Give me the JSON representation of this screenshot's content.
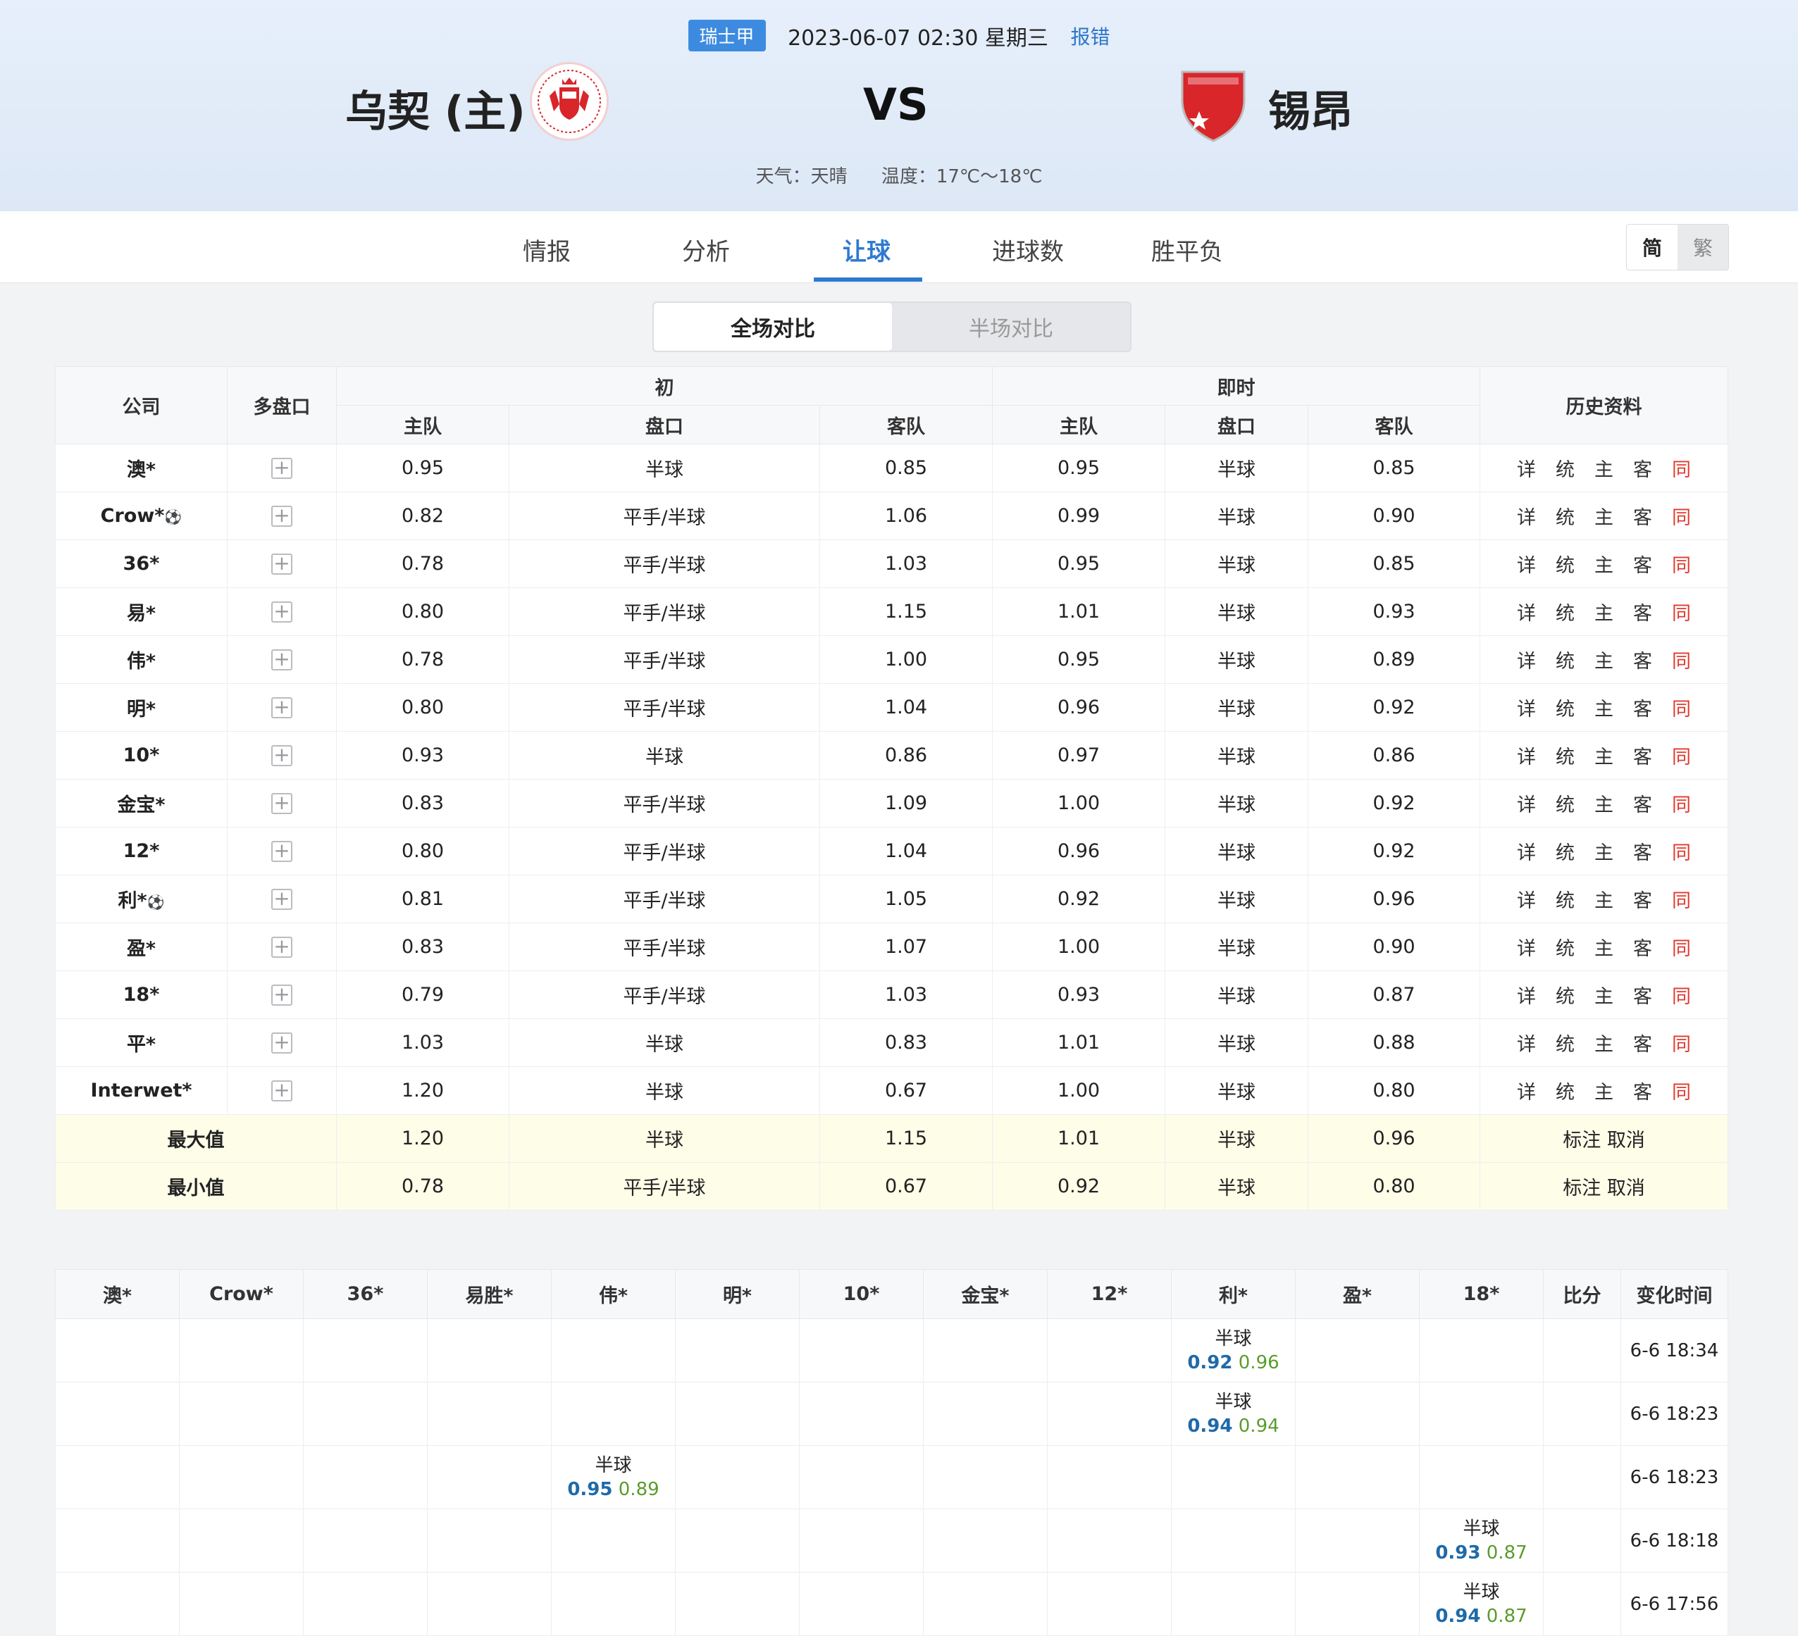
{
  "match": {
    "league": "瑞士甲",
    "datetime": "2023-06-07 02:30 星期三",
    "report": "报错",
    "home": "乌契 (主)",
    "vs": "VS",
    "away": "锡昂",
    "weather": "天气：天晴",
    "temperature": "温度：17℃～18℃"
  },
  "tabs": [
    "情报",
    "分析",
    "让球",
    "进球数",
    "胜平负"
  ],
  "lang": {
    "simplified": "简",
    "traditional": "繁"
  },
  "segment": {
    "full": "全场对比",
    "half": "半场对比"
  },
  "main_table": {
    "headers": {
      "company": "公司",
      "multi": "多盘口",
      "initial": "初",
      "live": "即时",
      "history": "历史资料",
      "home": "主队",
      "line": "盘口",
      "away": "客队"
    },
    "history_labels": [
      "详",
      "统",
      "主",
      "客",
      "同"
    ],
    "rows": [
      {
        "company": "澳*",
        "ball": false,
        "i_home": "0.95",
        "i_line": "半球",
        "i_away": "0.85",
        "l_home": "0.95",
        "l_line": "半球",
        "l_away": "0.85"
      },
      {
        "company": "Crow*",
        "ball": true,
        "i_home": "0.82",
        "i_line": "平手/半球",
        "i_away": "1.06",
        "l_home": "0.99",
        "l_line": "半球",
        "l_away": "0.90"
      },
      {
        "company": "36*",
        "ball": false,
        "i_home": "0.78",
        "i_line": "平手/半球",
        "i_away": "1.03",
        "l_home": "0.95",
        "l_line": "半球",
        "l_away": "0.85"
      },
      {
        "company": "易*",
        "ball": false,
        "i_home": "0.80",
        "i_line": "平手/半球",
        "i_away": "1.15",
        "l_home": "1.01",
        "l_line": "半球",
        "l_away": "0.93"
      },
      {
        "company": "伟*",
        "ball": false,
        "i_home": "0.78",
        "i_line": "平手/半球",
        "i_away": "1.00",
        "l_home": "0.95",
        "l_line": "半球",
        "l_away": "0.89"
      },
      {
        "company": "明*",
        "ball": false,
        "i_home": "0.80",
        "i_line": "平手/半球",
        "i_away": "1.04",
        "l_home": "0.96",
        "l_line": "半球",
        "l_away": "0.92"
      },
      {
        "company": "10*",
        "ball": false,
        "i_home": "0.93",
        "i_line": "半球",
        "i_away": "0.86",
        "l_home": "0.97",
        "l_line": "半球",
        "l_away": "0.86"
      },
      {
        "company": "金宝*",
        "ball": false,
        "i_home": "0.83",
        "i_line": "平手/半球",
        "i_away": "1.09",
        "l_home": "1.00",
        "l_line": "半球",
        "l_away": "0.92"
      },
      {
        "company": "12*",
        "ball": false,
        "i_home": "0.80",
        "i_line": "平手/半球",
        "i_away": "1.04",
        "l_home": "0.96",
        "l_line": "半球",
        "l_away": "0.92"
      },
      {
        "company": "利*",
        "ball": true,
        "i_home": "0.81",
        "i_line": "平手/半球",
        "i_away": "1.05",
        "l_home": "0.92",
        "l_line": "半球",
        "l_away": "0.96"
      },
      {
        "company": "盈*",
        "ball": false,
        "i_home": "0.83",
        "i_line": "平手/半球",
        "i_away": "1.07",
        "l_home": "1.00",
        "l_line": "半球",
        "l_away": "0.90"
      },
      {
        "company": "18*",
        "ball": false,
        "i_home": "0.79",
        "i_line": "平手/半球",
        "i_away": "1.03",
        "l_home": "0.93",
        "l_line": "半球",
        "l_away": "0.87"
      },
      {
        "company": "平*",
        "ball": false,
        "i_home": "1.03",
        "i_line": "半球",
        "i_away": "0.83",
        "l_home": "1.01",
        "l_line": "半球",
        "l_away": "0.88"
      },
      {
        "company": "Interwet*",
        "ball": false,
        "i_home": "1.20",
        "i_line": "半球",
        "i_away": "0.67",
        "l_home": "1.00",
        "l_line": "半球",
        "l_away": "0.80"
      }
    ],
    "summary": [
      {
        "label": "最大值",
        "i_home": "1.20",
        "i_line": "半球",
        "i_away": "1.15",
        "l_home": "1.01",
        "l_line": "半球",
        "l_away": "0.96",
        "mark": "标注",
        "cancel": "取消"
      },
      {
        "label": "最小值",
        "i_home": "0.78",
        "i_line": "平手/半球",
        "i_away": "0.67",
        "l_home": "0.92",
        "l_line": "半球",
        "l_away": "0.80",
        "mark": "标注",
        "cancel": "取消"
      }
    ]
  },
  "change_table": {
    "headers": [
      "澳*",
      "Crow*",
      "36*",
      "易胜*",
      "伟*",
      "明*",
      "10*",
      "金宝*",
      "12*",
      "利*",
      "盈*",
      "18*",
      "比分",
      "变化时间"
    ],
    "rows": [
      {
        "col": 9,
        "line": "半球",
        "home": "0.92",
        "away": "0.96",
        "time": "6-6 18:34"
      },
      {
        "col": 9,
        "line": "半球",
        "home": "0.94",
        "away": "0.94",
        "time": "6-6 18:23"
      },
      {
        "col": 4,
        "line": "半球",
        "home": "0.95",
        "away": "0.89",
        "time": "6-6 18:23"
      },
      {
        "col": 11,
        "line": "半球",
        "home": "0.93",
        "away": "0.87",
        "time": "6-6 18:18"
      },
      {
        "col": 11,
        "line": "半球",
        "home": "0.94",
        "away": "0.87",
        "time": "6-6 17:56"
      }
    ]
  }
}
